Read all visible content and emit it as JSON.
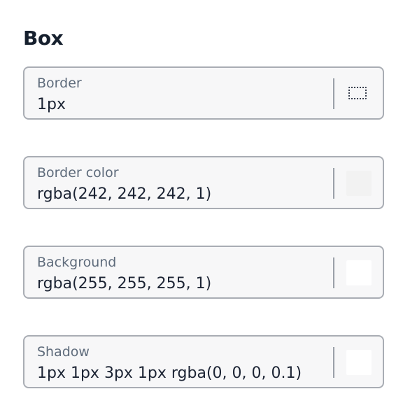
{
  "section": {
    "title": "Box"
  },
  "fields": [
    {
      "label": "Border",
      "value": "1px",
      "adornment_icon": "border-style-icon"
    },
    {
      "label": "Border color",
      "value": "rgba(242, 242, 242, 1)",
      "swatch_color": "#f2f2f2"
    },
    {
      "label": "Background",
      "value": "rgba(255, 255, 255, 1)",
      "swatch_color": "#ffffff"
    },
    {
      "label": "Shadow",
      "value": "1px 1px 3px 1px rgba(0, 0, 0, 0.1)",
      "swatch_color": "#ffffff"
    }
  ]
}
